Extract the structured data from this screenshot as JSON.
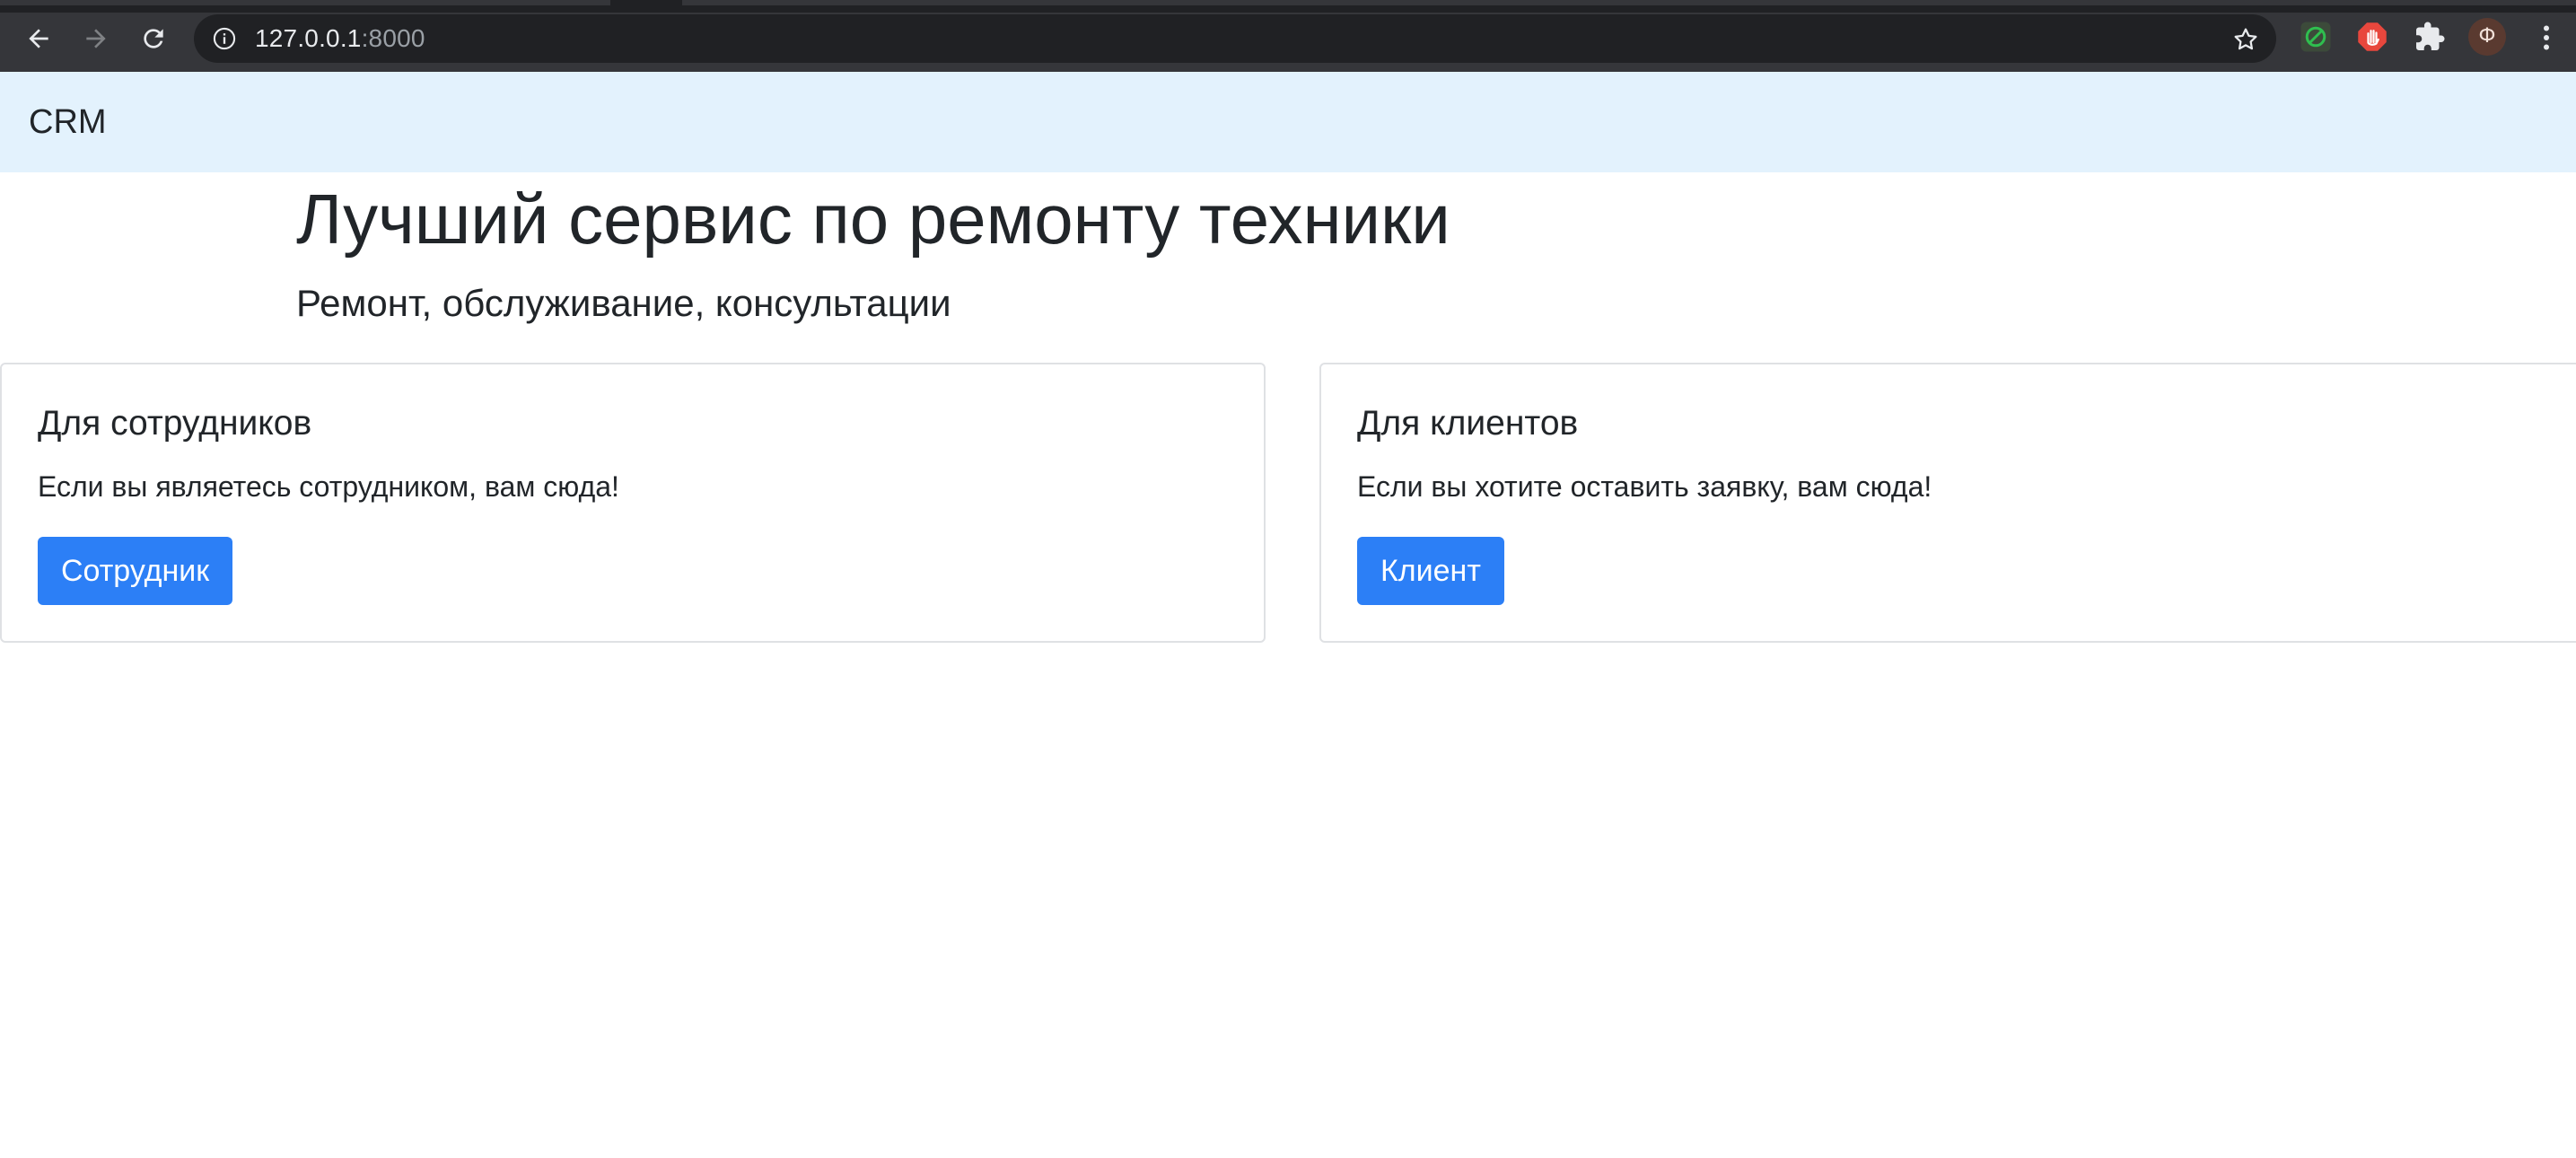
{
  "browser": {
    "url_host": "127.0.0.1",
    "url_port": ":8000",
    "profile_initial": "Ф",
    "icons": {
      "back": "back-arrow-icon",
      "forward": "forward-arrow-icon",
      "reload": "reload-icon",
      "info": "site-info-icon",
      "bookmark": "bookmark-star-icon",
      "extension_1": "green-circle-extension-icon",
      "extension_2": "adblock-hand-icon",
      "extensions": "puzzle-icon",
      "menu": "kebab-menu-icon"
    }
  },
  "navbar": {
    "brand": "CRM",
    "background": "#e3f2fd"
  },
  "hero": {
    "title": "Лучший сервис по ремонту техники",
    "subtitle": "Ремонт, обслуживание, консультации"
  },
  "cards": [
    {
      "title": "Для сотрудников",
      "text": "Если вы являетесь сотрудником, вам сюда!",
      "button_label": "Сотрудник"
    },
    {
      "title": "Для клиентов",
      "text": "Если вы хотите оставить заявку, вам сюда!",
      "button_label": "Клиент"
    }
  ],
  "colors": {
    "primary_button": "#2c7ff6",
    "chrome_bg": "#35363a",
    "omnibox_bg": "#202124"
  }
}
